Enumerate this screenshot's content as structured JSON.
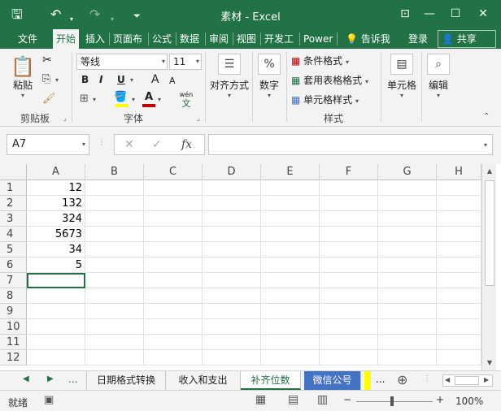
{
  "window": {
    "title": "素材 - Excel"
  },
  "ribbon_tabs": [
    {
      "label": "文件"
    },
    {
      "label": "开始"
    },
    {
      "label": "插入"
    },
    {
      "label": "页面布"
    },
    {
      "label": "公式"
    },
    {
      "label": "数据"
    },
    {
      "label": "审阅"
    },
    {
      "label": "视图"
    },
    {
      "label": "开发工"
    },
    {
      "label": "Power"
    },
    {
      "label": "告诉我"
    },
    {
      "label": "登录"
    },
    {
      "label": "共享"
    }
  ],
  "ribbon": {
    "clipboard": {
      "paste_label": "粘贴",
      "group_label": "剪贴板"
    },
    "font": {
      "font_name": "等线",
      "font_size": "11",
      "bold": "B",
      "italic": "I",
      "underline": "U",
      "grow": "A",
      "shrink": "A",
      "group_label": "字体",
      "phonetic": "wén",
      "font_color_letter": "A"
    },
    "alignment": {
      "label": "对齐方式"
    },
    "number": {
      "label": "数字",
      "icon": "%"
    },
    "styles": {
      "conditional": "条件格式",
      "table": "套用表格格式",
      "cell": "单元格样式",
      "group_label": "样式"
    },
    "cells": {
      "label": "单元格"
    },
    "editing": {
      "label": "编辑"
    }
  },
  "formula_bar": {
    "name_box": "A7",
    "fx": "fx",
    "formula": ""
  },
  "grid": {
    "columns": [
      "A",
      "B",
      "C",
      "D",
      "E",
      "F",
      "G",
      "H"
    ],
    "rows": [
      "1",
      "2",
      "3",
      "4",
      "5",
      "6",
      "7",
      "8",
      "9",
      "10",
      "11",
      "12"
    ],
    "col_a_values": [
      "12",
      "132",
      "324",
      "5673",
      "34",
      "5"
    ]
  },
  "sheet_tabs": {
    "ellipsis_left": "...",
    "tabs": [
      {
        "label": "日期格式转换"
      },
      {
        "label": "收入和支出"
      },
      {
        "label": "补齐位数"
      },
      {
        "label": "微信公号"
      }
    ],
    "ellipsis_right": "..."
  },
  "status_bar": {
    "ready": "就绪",
    "zoom": "100%"
  },
  "colors": {
    "excel_green": "#217346",
    "selected_tab_blue": "#4472c4",
    "highlight_yellow": "#ffff00",
    "font_color_red": "#c00000"
  }
}
